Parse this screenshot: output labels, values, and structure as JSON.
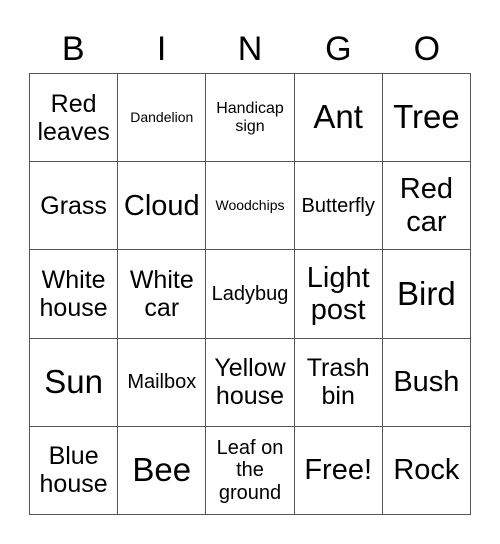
{
  "header": [
    "B",
    "I",
    "N",
    "G",
    "O"
  ],
  "cells": [
    {
      "text": "Red leaves",
      "size": "m"
    },
    {
      "text": "Dandelion",
      "size": "xxs"
    },
    {
      "text": "Handicap sign",
      "size": "xs"
    },
    {
      "text": "Ant",
      "size": "xl"
    },
    {
      "text": "Tree",
      "size": "xl"
    },
    {
      "text": "Grass",
      "size": "m"
    },
    {
      "text": "Cloud",
      "size": "l"
    },
    {
      "text": "Woodchips",
      "size": "xxs"
    },
    {
      "text": "Butterfly",
      "size": "sm"
    },
    {
      "text": "Red car",
      "size": "l"
    },
    {
      "text": "White house",
      "size": "m"
    },
    {
      "text": "White car",
      "size": "m"
    },
    {
      "text": "Ladybug",
      "size": "sm"
    },
    {
      "text": "Light post",
      "size": "l"
    },
    {
      "text": "Bird",
      "size": "xl"
    },
    {
      "text": "Sun",
      "size": "xl"
    },
    {
      "text": "Mailbox",
      "size": "sm"
    },
    {
      "text": "Yellow house",
      "size": "m"
    },
    {
      "text": "Trash bin",
      "size": "m"
    },
    {
      "text": "Bush",
      "size": "l"
    },
    {
      "text": "Blue house",
      "size": "m"
    },
    {
      "text": "Bee",
      "size": "xl"
    },
    {
      "text": "Leaf on the ground",
      "size": "sm"
    },
    {
      "text": "Free!",
      "size": "l"
    },
    {
      "text": "Rock",
      "size": "l"
    }
  ]
}
